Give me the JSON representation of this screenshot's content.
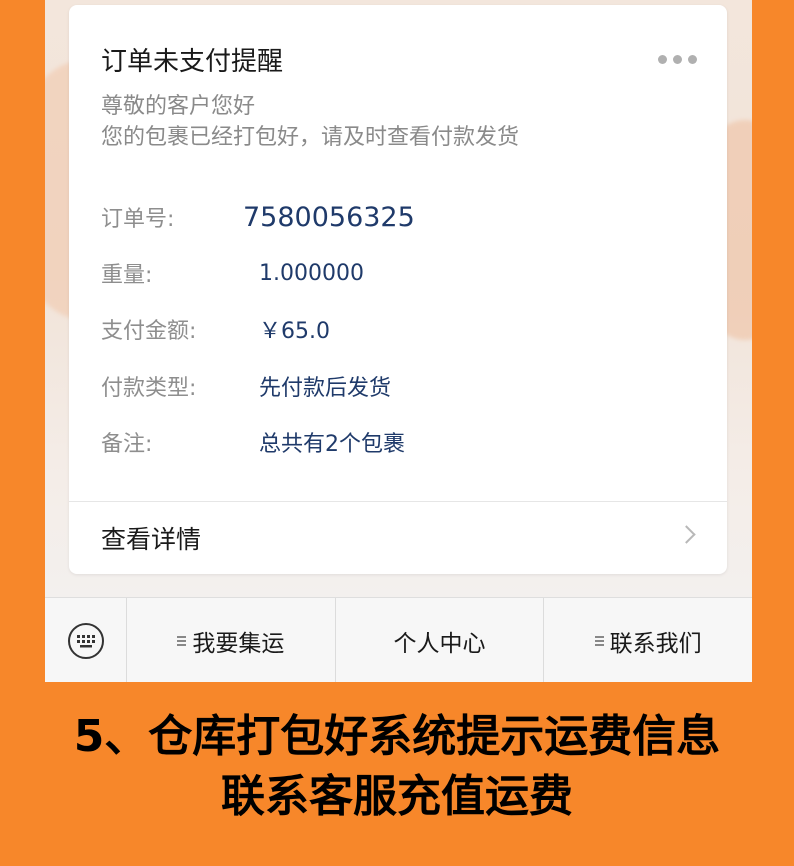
{
  "notification": {
    "title": "订单未支付提醒",
    "greeting_line1": "尊敬的客户您好",
    "greeting_line2": "您的包裹已经打包好，请及时查看付款发货",
    "fields": [
      {
        "label": "订单号:",
        "value": "7580056325"
      },
      {
        "label": "重量:",
        "value": "1.000000"
      },
      {
        "label": "支付金额:",
        "value": "￥65.0"
      },
      {
        "label": "付款类型:",
        "value": "先付款后发货"
      },
      {
        "label": "备注:",
        "value": "总共有2个包裹"
      }
    ],
    "details_label": "查看详情",
    "more_icon": "more-dots-icon",
    "chevron_icon": "chevron-right-icon"
  },
  "bottom_menu": {
    "keyboard_icon": "keyboard-icon",
    "items": [
      {
        "label": "我要集运",
        "has_menu_icon": true
      },
      {
        "label": "个人中心",
        "has_menu_icon": false
      },
      {
        "label": "联系我们",
        "has_menu_icon": true
      }
    ]
  },
  "caption": {
    "line1": "5、仓库打包好系统提示运费信息",
    "line2": "联系客服充值运费"
  },
  "colors": {
    "background": "#f7872a",
    "value_text": "#1f3a6a",
    "label_text": "#8e8e8e"
  }
}
